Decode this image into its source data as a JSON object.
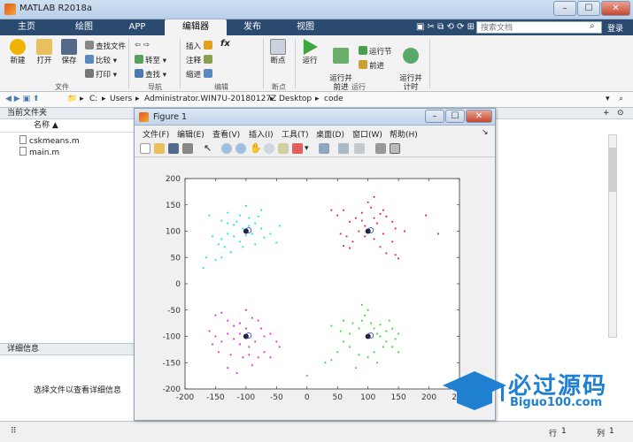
{
  "app": {
    "title": "MATLAB R2018a"
  },
  "window_buttons": [
    "–",
    "☐",
    "✕"
  ],
  "tabs": [
    "主页",
    "绘图",
    "APP",
    "编辑器",
    "发布",
    "视图"
  ],
  "active_tab": "编辑器",
  "search": {
    "placeholder": "搜索文档"
  },
  "ribbon": {
    "file": {
      "new": "新建",
      "open": "打开",
      "save": "保存",
      "find_files": "查找文件",
      "compare": "比较",
      "print": "打印",
      "group": "文件"
    },
    "nav": {
      "goto": "转至",
      "find": "查找",
      "group": "导航"
    },
    "edit": {
      "insert": "插入",
      "comment": "注释",
      "indent": "缩进",
      "fx": "fx",
      "group": "编辑"
    },
    "breakpoints": {
      "label": "断点",
      "group": "断点"
    },
    "run": {
      "run": "运行",
      "run_advance": "运行并\n前进",
      "run_section": "运行节",
      "advance": "前进",
      "run_time": "运行并\n计时",
      "group": "运行"
    }
  },
  "address": {
    "parts": [
      "C:",
      "Users",
      "Administrator.WIN7U-20180127Z",
      "Desktop",
      "code"
    ]
  },
  "current_folder": {
    "title": "当前文件夹",
    "col_name": "名称 ▲",
    "files": [
      "cskmeans.m",
      "main.m"
    ]
  },
  "details": {
    "title": "详细信息",
    "message": "选择文件以查看详细信息"
  },
  "figure": {
    "title": "Figure 1",
    "menu": [
      "文件(F)",
      "编辑(E)",
      "查看(V)",
      "插入(I)",
      "工具(T)",
      "桌面(D)",
      "窗口(W)",
      "帮助(H)"
    ]
  },
  "status": {
    "row_label": "行",
    "row": "1",
    "col_label": "列",
    "col": "1"
  },
  "watermark": {
    "text": "必过源码",
    "url": "Biguo100.com"
  },
  "colors": {
    "cyan": "#00e5ee",
    "red": "#e31a1c",
    "magenta": "#e01ee0",
    "green": "#22dd22",
    "ribbon_dark": "#2b4a6f"
  },
  "chart_data": {
    "type": "scatter",
    "xlim": [
      -200,
      250
    ],
    "ylim": [
      -200,
      200
    ],
    "xticks": [
      -200,
      -150,
      -100,
      -50,
      0,
      50,
      100,
      150,
      200,
      250
    ],
    "yticks": [
      -200,
      -150,
      -100,
      -50,
      0,
      50,
      100,
      150,
      200
    ],
    "series": [
      {
        "color": "#00e5ee",
        "center": [
          -100,
          100
        ],
        "points": [
          [
            -160,
            130
          ],
          [
            -140,
            120
          ],
          [
            -130,
            135
          ],
          [
            -120,
            112
          ],
          [
            -110,
            130
          ],
          [
            -100,
            148
          ],
          [
            -95,
            125
          ],
          [
            -85,
            115
          ],
          [
            -80,
            128
          ],
          [
            -75,
            105
          ],
          [
            -130,
            95
          ],
          [
            -120,
            90
          ],
          [
            -140,
            85
          ],
          [
            -145,
            75
          ],
          [
            -135,
            70
          ],
          [
            -110,
            80
          ],
          [
            -100,
            92
          ],
          [
            -90,
            95
          ],
          [
            -70,
            88
          ],
          [
            -60,
            95
          ],
          [
            -45,
            110
          ],
          [
            -50,
            78
          ],
          [
            -125,
            60
          ],
          [
            -140,
            50
          ],
          [
            -150,
            45
          ],
          [
            -165,
            50
          ],
          [
            -170,
            30
          ],
          [
            -155,
            90
          ],
          [
            -105,
            105
          ],
          [
            -95,
            110
          ],
          [
            -115,
            118
          ],
          [
            -75,
            140
          ],
          [
            -130,
            115
          ],
          [
            -105,
            70
          ],
          [
            -85,
            75
          ]
        ]
      },
      {
        "color": "#e31a1c",
        "center": [
          100,
          100
        ],
        "points": [
          [
            40,
            140
          ],
          [
            50,
            130
          ],
          [
            60,
            140
          ],
          [
            70,
            118
          ],
          [
            80,
            125
          ],
          [
            90,
            135
          ],
          [
            95,
            110
          ],
          [
            100,
            155
          ],
          [
            105,
            145
          ],
          [
            110,
            125
          ],
          [
            115,
            115
          ],
          [
            120,
            133
          ],
          [
            125,
            140
          ],
          [
            130,
            128
          ],
          [
            140,
            118
          ],
          [
            145,
            105
          ],
          [
            160,
            100
          ],
          [
            195,
            130
          ],
          [
            215,
            95
          ],
          [
            55,
            95
          ],
          [
            65,
            90
          ],
          [
            75,
            80
          ],
          [
            85,
            100
          ],
          [
            95,
            90
          ],
          [
            110,
            85
          ],
          [
            120,
            70
          ],
          [
            130,
            58
          ],
          [
            145,
            55
          ],
          [
            150,
            48
          ],
          [
            70,
            68
          ],
          [
            60,
            72
          ],
          [
            110,
            165
          ],
          [
            90,
            120
          ],
          [
            125,
            95
          ],
          [
            140,
            80
          ]
        ]
      },
      {
        "color": "#e01ee0",
        "center": [
          -100,
          -100
        ],
        "points": [
          [
            -150,
            -60
          ],
          [
            -140,
            -55
          ],
          [
            -130,
            -70
          ],
          [
            -120,
            -80
          ],
          [
            -110,
            -75
          ],
          [
            -100,
            -50
          ],
          [
            -90,
            -65
          ],
          [
            -80,
            -70
          ],
          [
            -75,
            -85
          ],
          [
            -160,
            -90
          ],
          [
            -150,
            -100
          ],
          [
            -140,
            -110
          ],
          [
            -130,
            -95
          ],
          [
            -120,
            -105
          ],
          [
            -110,
            -115
          ],
          [
            -95,
            -120
          ],
          [
            -85,
            -110
          ],
          [
            -70,
            -100
          ],
          [
            -60,
            -95
          ],
          [
            -50,
            -110
          ],
          [
            -45,
            -120
          ],
          [
            -70,
            -130
          ],
          [
            -80,
            -140
          ],
          [
            -95,
            -135
          ],
          [
            -105,
            -140
          ],
          [
            -125,
            -135
          ],
          [
            -145,
            -130
          ],
          [
            -155,
            -115
          ],
          [
            -130,
            -160
          ],
          [
            -115,
            -170
          ],
          [
            -90,
            -155
          ],
          [
            -60,
            -140
          ],
          [
            -100,
            -85
          ],
          [
            -110,
            -95
          ]
        ]
      },
      {
        "color": "#22dd22",
        "center": [
          100,
          -100
        ],
        "points": [
          [
            40,
            -80
          ],
          [
            55,
            -90
          ],
          [
            60,
            -70
          ],
          [
            70,
            -95
          ],
          [
            75,
            -75
          ],
          [
            85,
            -85
          ],
          [
            90,
            -70
          ],
          [
            95,
            -60
          ],
          [
            100,
            -50
          ],
          [
            105,
            -75
          ],
          [
            110,
            -85
          ],
          [
            115,
            -95
          ],
          [
            120,
            -78
          ],
          [
            130,
            -90
          ],
          [
            135,
            -70
          ],
          [
            140,
            -85
          ],
          [
            145,
            -105
          ],
          [
            150,
            -95
          ],
          [
            120,
            -100
          ],
          [
            130,
            -110
          ],
          [
            125,
            -120
          ],
          [
            140,
            -120
          ],
          [
            110,
            -130
          ],
          [
            100,
            -140
          ],
          [
            85,
            -135
          ],
          [
            70,
            -120
          ],
          [
            60,
            -110
          ],
          [
            50,
            -130
          ],
          [
            40,
            -145
          ],
          [
            30,
            -150
          ],
          [
            80,
            -160
          ],
          [
            0,
            -175
          ],
          [
            90,
            -40
          ],
          [
            115,
            -150
          ],
          [
            150,
            -130
          ]
        ]
      }
    ]
  }
}
